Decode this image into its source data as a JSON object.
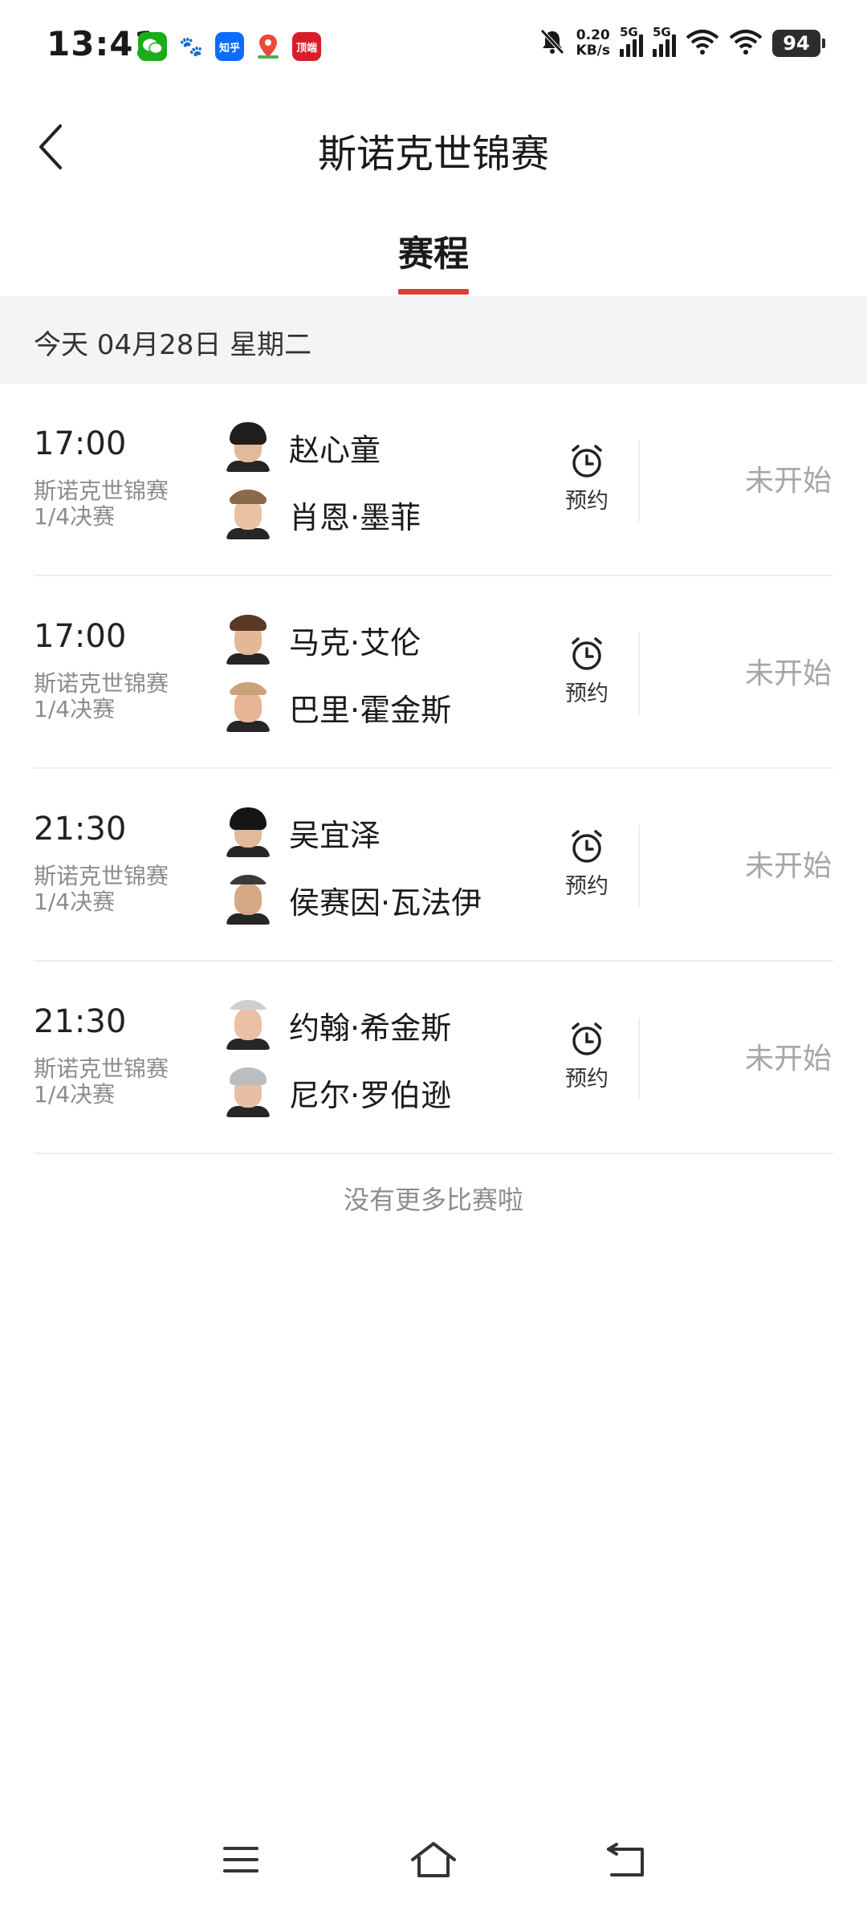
{
  "status_bar": {
    "time": "13:41",
    "apps": [
      {
        "name": "wechat-icon",
        "glyph": ""
      },
      {
        "name": "baidu-icon",
        "glyph": "🐾"
      },
      {
        "name": "zhihu-icon",
        "glyph": "知乎"
      },
      {
        "name": "maps-icon",
        "glyph": ""
      },
      {
        "name": "news-icon",
        "glyph": "顶端"
      }
    ],
    "net_speed_value": "0.20",
    "net_speed_unit": "KB/s",
    "sim1_label": "5G",
    "sim2_label": "5G",
    "battery": "94"
  },
  "header": {
    "title": "斯诺克世锦赛"
  },
  "tabs": {
    "active": "赛程"
  },
  "date_bar": {
    "text": "今天 04月28日 星期二"
  },
  "matches": [
    {
      "time": "17:00",
      "event": "斯诺克世锦赛",
      "round": "1/4决赛",
      "player1": {
        "name": "赵心童"
      },
      "player2": {
        "name": "肖恩·墨菲"
      },
      "reserve_label": "预约",
      "status": "未开始"
    },
    {
      "time": "17:00",
      "event": "斯诺克世锦赛",
      "round": "1/4决赛",
      "player1": {
        "name": "马克·艾伦"
      },
      "player2": {
        "name": "巴里·霍金斯"
      },
      "reserve_label": "预约",
      "status": "未开始"
    },
    {
      "time": "21:30",
      "event": "斯诺克世锦赛",
      "round": "1/4决赛",
      "player1": {
        "name": "吴宜泽"
      },
      "player2": {
        "name": "侯赛因·瓦法伊"
      },
      "reserve_label": "预约",
      "status": "未开始"
    },
    {
      "time": "21:30",
      "event": "斯诺克世锦赛",
      "round": "1/4决赛",
      "player1": {
        "name": "约翰·希金斯"
      },
      "player2": {
        "name": "尼尔·罗伯逊"
      },
      "reserve_label": "预约",
      "status": "未开始"
    }
  ],
  "footer_note": "没有更多比赛啦",
  "colors": {
    "accent": "#e0403a",
    "date_bar_bg": "#f3f4f6",
    "muted_text": "#8c8c8c",
    "status_text": "#a6a6a6"
  }
}
